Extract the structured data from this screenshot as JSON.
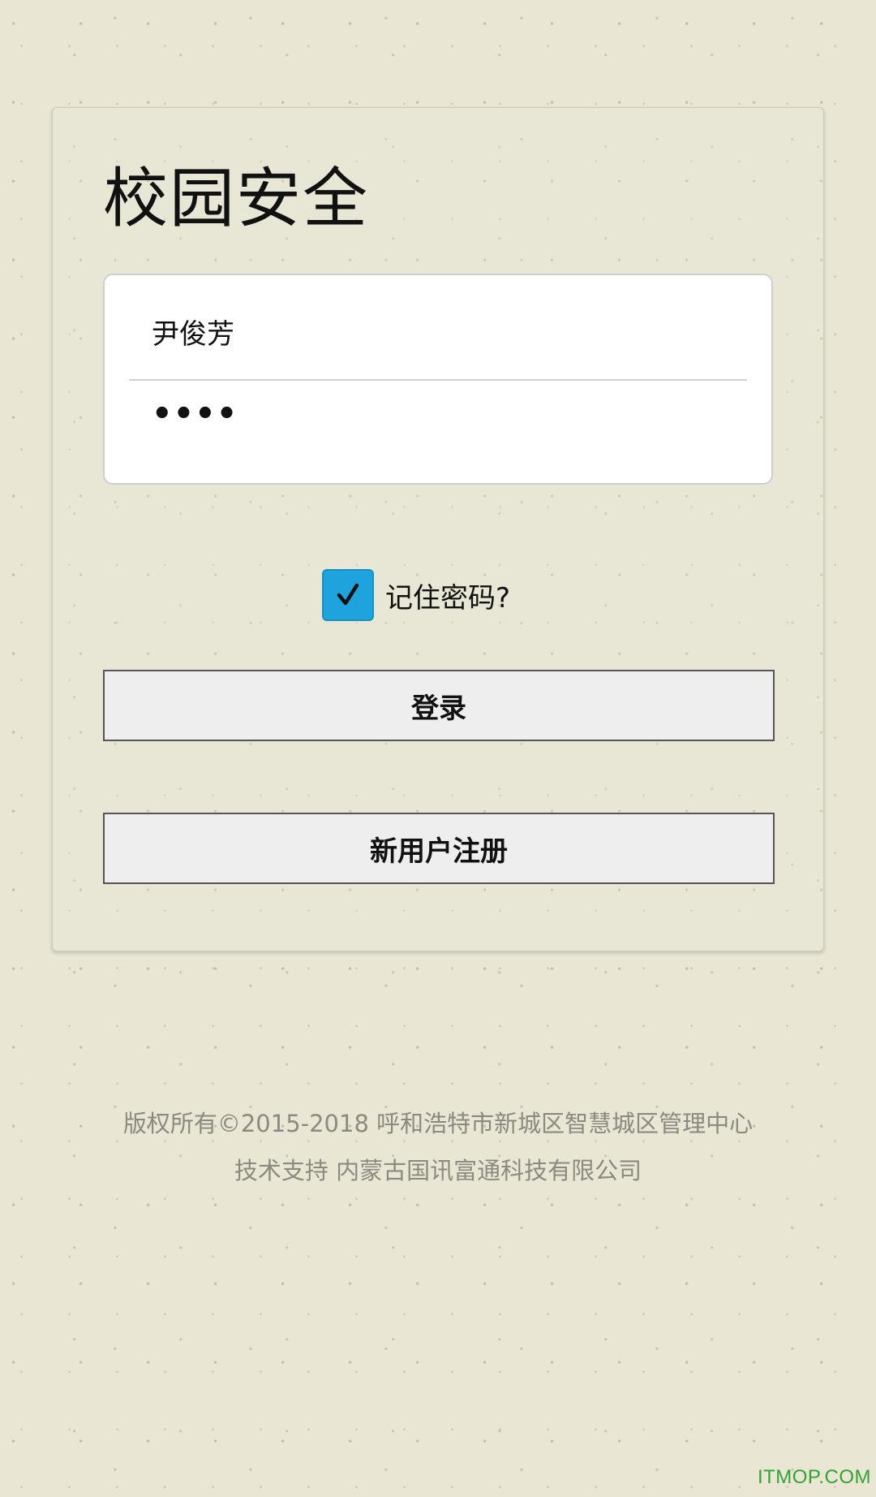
{
  "login_card": {
    "title": "校园安全",
    "username_value": "尹俊芳",
    "password_value": "••••",
    "remember": {
      "label": "记住密码?",
      "checked": true
    },
    "login_button": "登录",
    "register_button": "新用户注册"
  },
  "footer": {
    "copyright": "版权所有©2015-2018 呼和浩特市新城区智慧城区管理中心",
    "support": "技术支持 内蒙古国讯富通科技有限公司"
  },
  "watermark": "ITMOP.COM",
  "colors": {
    "background": "#e9e6d4",
    "checkbox": "#1ea3df",
    "button_bg": "#eeeeee",
    "footer_text": "#8c8a80",
    "watermark": "#33a133"
  },
  "icons": {
    "checkbox_mark": "check-icon"
  }
}
